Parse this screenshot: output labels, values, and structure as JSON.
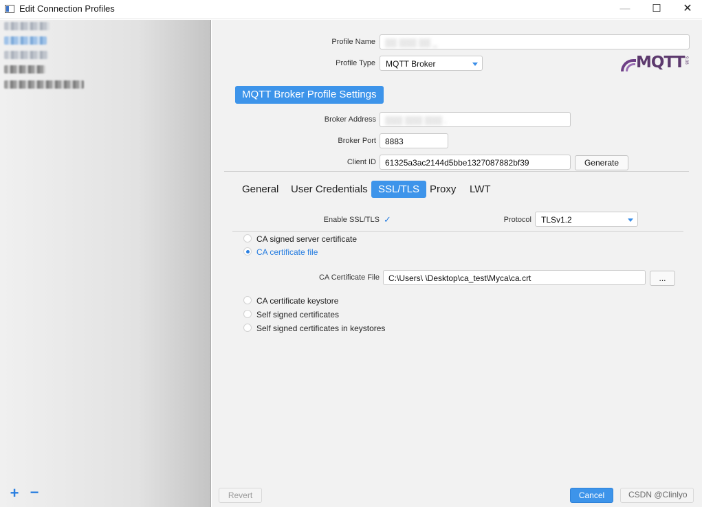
{
  "window": {
    "title": "Edit Connection Profiles",
    "minimize_glyph": "—",
    "maximize_glyph": "☐",
    "close_glyph": "✕"
  },
  "sidebar": {
    "add_glyph": "+",
    "remove_glyph": "−"
  },
  "form": {
    "profile_name_label": "Profile Name",
    "profile_type_label": "Profile Type",
    "profile_type_value": "MQTT Broker",
    "logo_text": "MQTT",
    "logo_tag": "9.08",
    "section_header": "MQTT Broker Profile Settings",
    "broker_address_label": "Broker Address",
    "broker_port_label": "Broker Port",
    "broker_port_value": "8883",
    "client_id_label": "Client ID",
    "client_id_value": "61325a3ac2144d5bbe1327087882bf39",
    "generate_label": "Generate"
  },
  "tabs": [
    {
      "label": "General"
    },
    {
      "label": "User Credentials"
    },
    {
      "label": "SSL/TLS"
    },
    {
      "label": "Proxy"
    },
    {
      "label": "LWT"
    }
  ],
  "ssl": {
    "enable_label": "Enable SSL/TLS",
    "enabled_glyph": "✓",
    "protocol_label": "Protocol",
    "protocol_value": "TLSv1.2",
    "options": [
      {
        "label": "CA signed server certificate"
      },
      {
        "label": "CA certificate file"
      },
      {
        "label": "CA certificate keystore"
      },
      {
        "label": "Self signed certificates"
      },
      {
        "label": "Self signed certificates in keystores"
      }
    ],
    "ca_file_label": "CA Certificate File",
    "ca_file_value": "C:\\Users\\        \\Desktop\\ca_test\\Myca\\ca.crt",
    "browse_label": "..."
  },
  "footer": {
    "revert_label": "Revert",
    "cancel_label": "Cancel",
    "watermark": "CSDN @Clinlyo"
  },
  "colors": {
    "accent": "#3d94ea",
    "sidebar_bg": "#e2e2e2",
    "panel_bg": "#f2f2f2",
    "logo": "#5d3a6e"
  }
}
